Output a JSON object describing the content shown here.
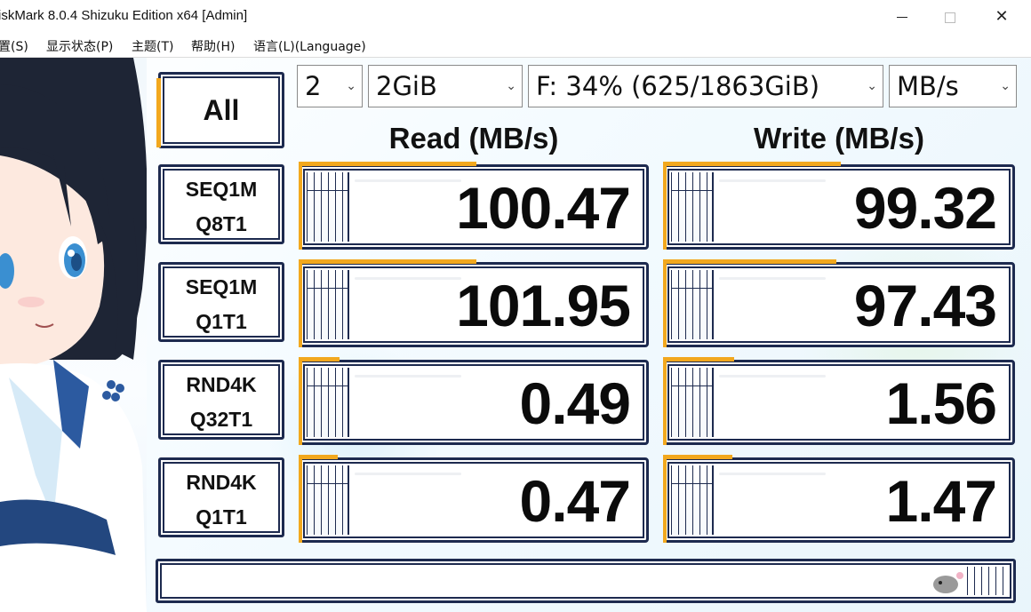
{
  "window": {
    "title": "iskMark 8.0.4 Shizuku Edition x64 [Admin]",
    "minimize_label": "",
    "close_label": "✕"
  },
  "menu": {
    "items": [
      "置(S)",
      "显示状态(P)",
      "主题(T)",
      "帮助(H)",
      "语言(L)(Language)"
    ]
  },
  "controls": {
    "count": "2",
    "size": "2GiB",
    "drive": "F: 34% (625/1863GiB)",
    "unit": "MB/s",
    "chevron": "⌄"
  },
  "all_button": "All",
  "columns": {
    "read": "Read (MB/s)",
    "write": "Write (MB/s)"
  },
  "tests": [
    {
      "line1": "SEQ1M",
      "line2": "Q8T1",
      "read": "100.47",
      "write": "99.32"
    },
    {
      "line1": "SEQ1M",
      "line2": "Q1T1",
      "read": "101.95",
      "write": "97.43"
    },
    {
      "line1": "RND4K",
      "line2": "Q32T1",
      "read": "0.49",
      "write": "1.56"
    },
    {
      "line1": "RND4K",
      "line2": "Q1T1",
      "read": "0.47",
      "write": "1.47"
    }
  ],
  "progress": {
    "fraction": 0
  },
  "colors": {
    "accent": "#f2a81e",
    "frame": "#1d2a4f",
    "hair": "#1e2535",
    "eyes": "#3a8fd1"
  }
}
